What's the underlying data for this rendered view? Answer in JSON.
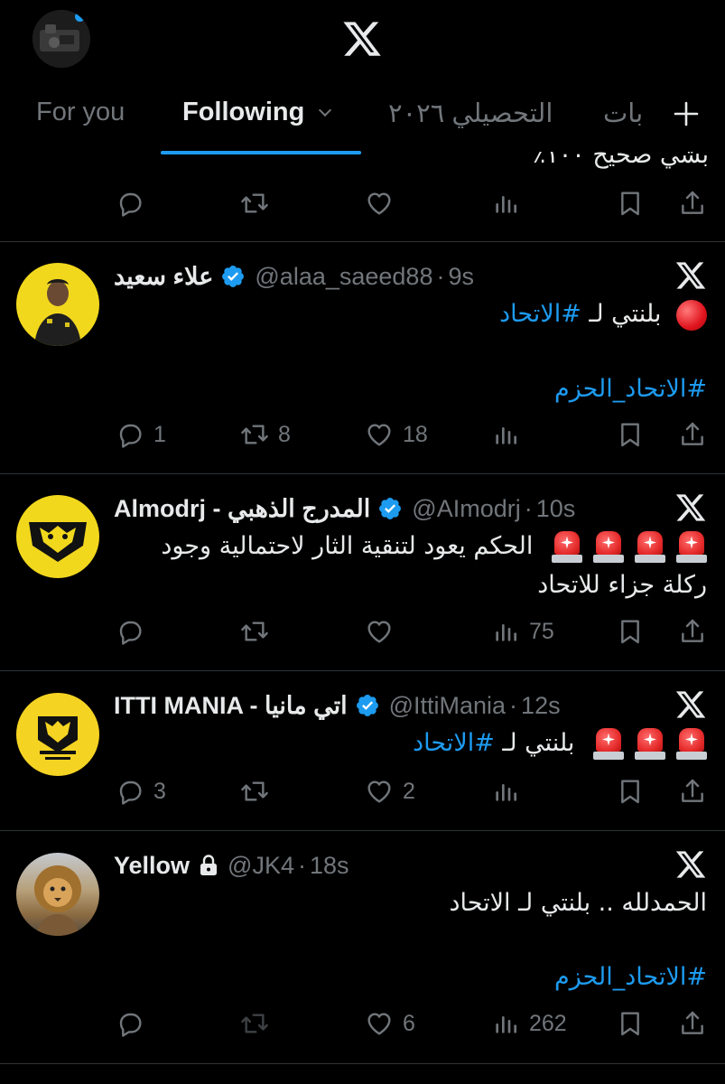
{
  "header": {
    "tabs": [
      {
        "label": "For you"
      },
      {
        "label": "Following"
      },
      {
        "label": "التحصيلي ٢٠٢٦"
      },
      {
        "label": "بات"
      }
    ]
  },
  "partial_post": {
    "text": "بشي صحيح ١٠٠٪"
  },
  "posts": [
    {
      "name": "علاء سعيد",
      "handle": "@alaa_saeed88",
      "time": "9s",
      "line1_text": "بلنتي لـ ",
      "line1_hashtag": "#الاتحاد",
      "line2_hashtag": "#الاتحاد_الحزم",
      "replies": "1",
      "reposts": "8",
      "likes": "18",
      "views": ""
    },
    {
      "name": "Almodrj - المدرج الذهبي",
      "handle": "@AImodrj",
      "time": "10s",
      "line1_text": "الحكم يعود لتنقية الثار لاحتمالية وجود",
      "line2_text": "ركلة جزاء للاتحاد",
      "replies": "",
      "reposts": "",
      "likes": "",
      "views": "75"
    },
    {
      "name": "ITTI MANIA - اتي مانيا",
      "handle": "@IttiMania",
      "time": "12s",
      "line1_text": "بلنتي لـ ",
      "line1_hashtag": "#الاتحاد",
      "replies": "3",
      "reposts": "",
      "likes": "2",
      "views": ""
    },
    {
      "name": "Yellow",
      "handle": "@JK4",
      "time": "18s",
      "line1_text": "الحمدلله .. بلنتي لـ الاتحاد",
      "line2_hashtag": "#الاتحاد_الحزم",
      "replies": "",
      "reposts": "",
      "likes": "6",
      "views": "262"
    }
  ],
  "colors": {
    "background": "#000000",
    "text": "#e7e9ea",
    "muted": "#71767b",
    "accent": "#1d9bf0",
    "divider": "#2f3336"
  },
  "icons": [
    "x-logo-icon",
    "plus-icon",
    "chevron-down-icon",
    "reply-icon",
    "repost-icon",
    "like-icon",
    "views-icon",
    "bookmark-icon",
    "share-icon",
    "verified-badge-icon",
    "lock-icon",
    "red-circle-emoji",
    "siren-emoji"
  ]
}
